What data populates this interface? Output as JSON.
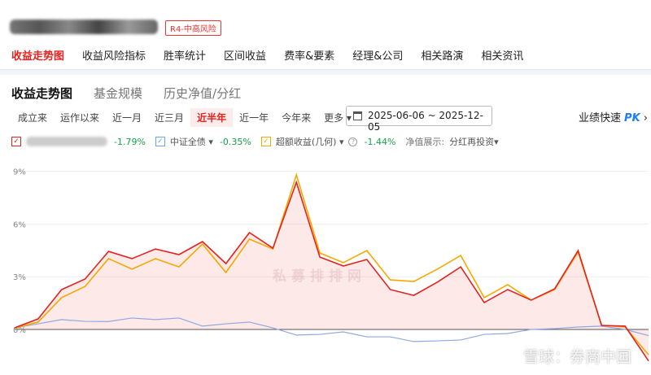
{
  "header": {
    "risk_badge": "R4-中高风险"
  },
  "tabs": [
    "收益走势图",
    "收益风险指标",
    "胜率统计",
    "区间收益",
    "费率&要素",
    "经理&公司",
    "相关路演",
    "相关资讯"
  ],
  "subtabs": [
    "收益走势图",
    "基金规模",
    "历史净值/分红"
  ],
  "ranges": [
    "成立来",
    "运作以来",
    "近一月",
    "近三月",
    "近半年",
    "近一年",
    "今年来",
    "更多 ▾"
  ],
  "active_range": "近半年",
  "date_range": "2025-06-06 ~ 2025-12-05",
  "pk": {
    "label": "业绩快速",
    "pk": "PK",
    "arrow": "›"
  },
  "legend": {
    "fund_return": "-1.79%",
    "benchmark": "中证全债 ▾",
    "benchmark_return": "-0.35%",
    "excess": "超额收益(几何) ▾",
    "excess_return": "-1.44%",
    "nav_label": "净值展示:",
    "nav_mode": "分红再投资▾"
  },
  "colors": {
    "fund": "#e4231e",
    "benchmark": "#8fa8e0",
    "excess": "#f5a800",
    "accent": "#e4231e"
  },
  "watermarks": [
    "私募排排网",
    "雪球：券商中国"
  ],
  "chart_data": {
    "type": "line",
    "ylim": [
      -2.6,
      9.5
    ],
    "yticks": [
      "9%",
      "6%",
      "3%",
      "0%"
    ],
    "ytick_values": [
      9,
      6,
      3,
      0
    ],
    "series": [
      {
        "key": "fund",
        "values": [
          0.09,
          0.6,
          2.27,
          2.87,
          4.44,
          4.03,
          4.58,
          4.26,
          5.0,
          3.75,
          5.51,
          4.63,
          8.38,
          4.12,
          3.61,
          3.98,
          2.27,
          1.94,
          2.69,
          3.56,
          1.53,
          2.27,
          1.67,
          2.31,
          4.49,
          0.23,
          0.19,
          -1.79
        ]
      },
      {
        "key": "excess",
        "values": [
          0.09,
          0.42,
          1.81,
          2.45,
          4.03,
          3.43,
          4.03,
          3.56,
          4.86,
          3.24,
          5.14,
          4.58,
          8.8,
          4.35,
          3.8,
          4.49,
          2.82,
          2.73,
          3.43,
          4.21,
          1.81,
          2.55,
          1.67,
          2.27,
          4.4,
          0.23,
          0.14,
          -1.44
        ]
      },
      {
        "key": "benchmark",
        "values": [
          0.09,
          0.32,
          0.56,
          0.46,
          0.45,
          0.65,
          0.56,
          0.65,
          0.19,
          0.32,
          0.42,
          0.09,
          -0.32,
          -0.28,
          -0.14,
          -0.42,
          -0.42,
          -0.69,
          -0.65,
          -0.6,
          -0.28,
          -0.23,
          0,
          0.05,
          0.14,
          0.19,
          0,
          -0.35
        ]
      }
    ]
  }
}
